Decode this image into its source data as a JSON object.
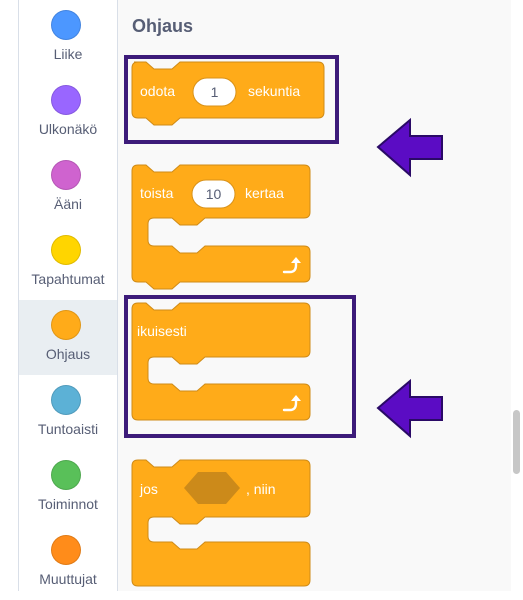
{
  "categories": [
    {
      "label": "Liike",
      "color": "#4c97ff"
    },
    {
      "label": "Ulkonäkö",
      "color": "#9966ff"
    },
    {
      "label": "Ääni",
      "color": "#cf63cf"
    },
    {
      "label": "Tapahtumat",
      "color": "#ffd500"
    },
    {
      "label": "Ohjaus",
      "color": "#ffab19",
      "selected": true
    },
    {
      "label": "Tuntoaisti",
      "color": "#5cb1d6"
    },
    {
      "label": "Toiminnot",
      "color": "#59c059"
    },
    {
      "label": "Muuttujat",
      "color": "#ff8c1a"
    }
  ],
  "palette": {
    "section_title": "Ohjaus",
    "blocks": {
      "wait": {
        "prefix": "odota",
        "value": "1",
        "suffix": "sekuntia"
      },
      "repeat": {
        "prefix": "toista",
        "value": "10",
        "suffix": "kertaa"
      },
      "forever": {
        "label": "ikuisesti"
      },
      "if": {
        "prefix": "jos",
        "suffix": ", niin"
      }
    }
  },
  "colors": {
    "control_block": "#ffab19",
    "control_block_border": "#cf8b17",
    "highlight_box": "#3d1b7a",
    "arrow": "#5b0cc4"
  },
  "icons": [
    "loop-arrow-icon"
  ]
}
